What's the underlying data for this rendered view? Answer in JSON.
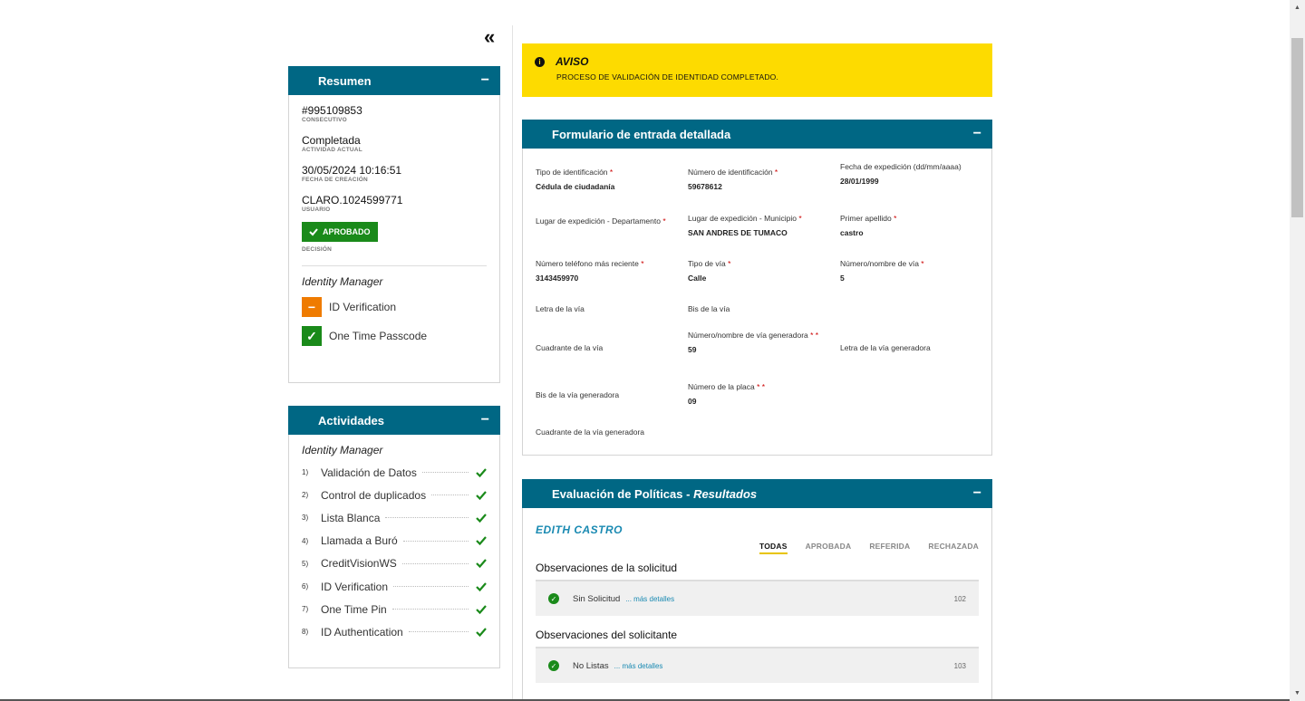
{
  "nav": {
    "collapse_icon": "«"
  },
  "resumen": {
    "title": "Resumen",
    "minimize": "−",
    "items": [
      {
        "value": "#995109853",
        "label": "CONSECUTIVO"
      },
      {
        "value": "Completada",
        "label": "ACTIVIDAD ACTUAL"
      },
      {
        "value": "30/05/2024 10:16:51",
        "label": "FECHA DE CREACIÓN"
      },
      {
        "value": "CLARO.1024599771",
        "label": "USUARIO"
      }
    ],
    "decision": {
      "badge": "APROBADO",
      "label": "DECISIÓN"
    },
    "identity_manager": {
      "title": "Identity Manager",
      "items": [
        {
          "label": "ID Verification",
          "status": "pending",
          "icon": "−",
          "color": "#ef7b00"
        },
        {
          "label": "One Time Passcode",
          "status": "done",
          "icon": "✓",
          "color": "#1a8a1a"
        }
      ]
    }
  },
  "actividades": {
    "title": "Actividades",
    "minimize": "−",
    "subtitle": "Identity Manager",
    "items": [
      {
        "num": "1)",
        "label": "Validación de Datos"
      },
      {
        "num": "2)",
        "label": "Control de duplicados"
      },
      {
        "num": "3)",
        "label": "Lista Blanca"
      },
      {
        "num": "4)",
        "label": "Llamada a Buró"
      },
      {
        "num": "5)",
        "label": "CreditVisionWS"
      },
      {
        "num": "6)",
        "label": "ID Verification"
      },
      {
        "num": "7)",
        "label": "One Time Pin"
      },
      {
        "num": "8)",
        "label": "ID Authentication"
      }
    ]
  },
  "aviso": {
    "title": "AVISO",
    "message": "PROCESO DE VALIDACIÓN DE IDENTIDAD COMPLETADO.",
    "background": "#fddb00"
  },
  "formulario": {
    "title": "Formulario de entrada detallada",
    "minimize": "−",
    "fields": [
      {
        "label": "Tipo de identificación",
        "req": " *",
        "value": "Cédula de ciudadanía"
      },
      {
        "label": "Número de identificación",
        "req": " *",
        "value": "59678612"
      },
      {
        "label": "Fecha de expedición (dd/mm/aaaa)",
        "req": "",
        "value": "28/01/1999"
      },
      {
        "label": "Lugar de expedición - Departamento",
        "req": " *",
        "value": ""
      },
      {
        "label": "Lugar de expedición - Municipio",
        "req": " *",
        "value": "SAN ANDRES DE TUMACO"
      },
      {
        "label": "Primer apellido",
        "req": " *",
        "value": "castro"
      },
      {
        "label": "Número teléfono más reciente",
        "req": " *",
        "value": "3143459970"
      },
      {
        "label": "Tipo de vía",
        "req": " *",
        "value": "Calle"
      },
      {
        "label": "Número/nombre de vía",
        "req": " *",
        "value": "5"
      },
      {
        "label": "Letra de la vía",
        "req": "",
        "value": ""
      },
      {
        "label": "Bis de la vía",
        "req": "",
        "value": ""
      },
      {
        "label": "Cuadrante de la vía",
        "req": "",
        "value": ""
      },
      {
        "label": "Número/nombre de vía generadora",
        "req": " * *",
        "value": "59"
      },
      {
        "label": "Letra de la vía generadora",
        "req": "",
        "value": ""
      },
      {
        "label": "Bis de la vía generadora",
        "req": "",
        "value": ""
      },
      {
        "label": "Número de la placa",
        "req": " * *",
        "value": "09"
      },
      {
        "label": "Cuadrante de la vía generadora",
        "req": "",
        "value": ""
      }
    ]
  },
  "evaluacion": {
    "title": "Evaluación de Políticas",
    "title_sep": " - ",
    "title_suffix": "Resultados",
    "minimize": "−",
    "person": "EDITH  CASTRO",
    "tabs": [
      "TODAS",
      "APROBADA",
      "REFERIDA",
      "RECHAZADA"
    ],
    "active_tab": "TODAS",
    "sections": [
      {
        "title": "Observaciones de la solicitud",
        "item": "Sin Solicitud",
        "more": "... más detalles",
        "code": "102"
      },
      {
        "title": "Observaciones del solicitante",
        "item": "No Listas",
        "more": "... más detalles",
        "code": "103"
      }
    ]
  },
  "colors": {
    "header": "#006784",
    "accent_green": "#1a8a1a",
    "accent_orange": "#ef7b00",
    "link": "#1a8ab2"
  }
}
